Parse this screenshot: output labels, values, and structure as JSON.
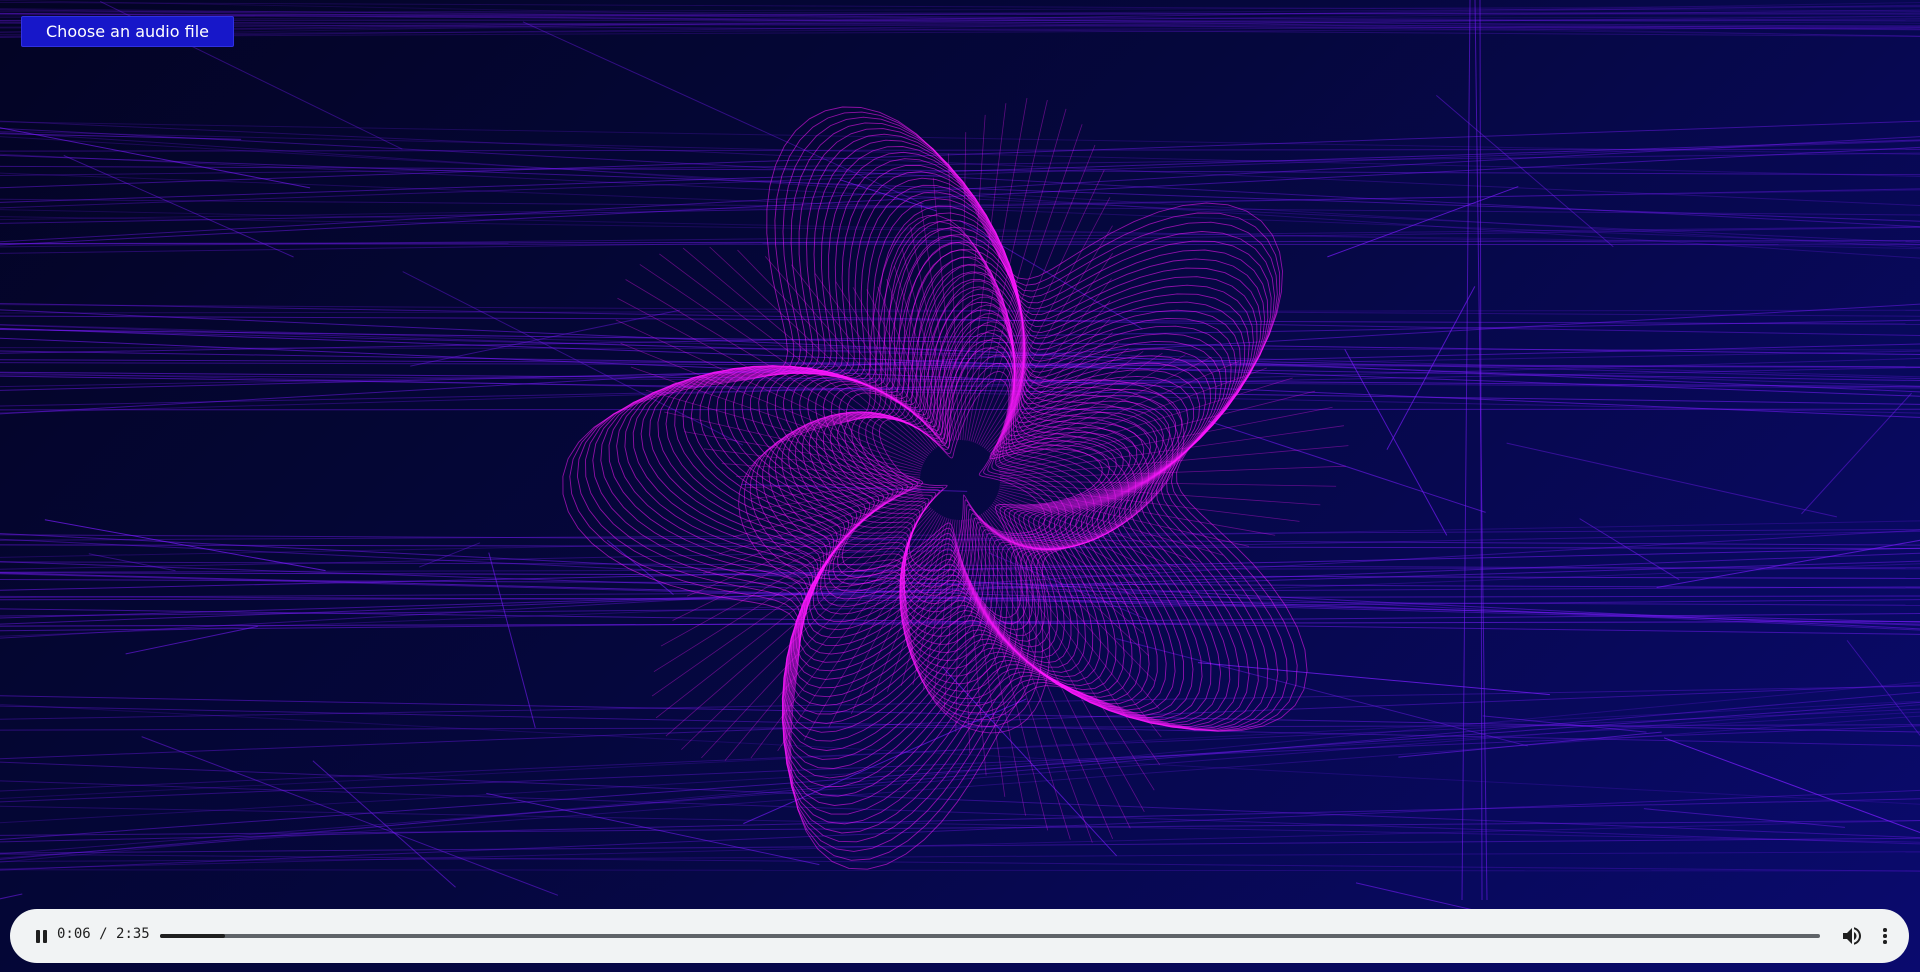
{
  "upload": {
    "label": "Choose an audio file"
  },
  "player": {
    "current_time": "0:06",
    "separator": " / ",
    "duration": "2:35",
    "progress_fraction": 0.039,
    "state": "playing"
  },
  "visual": {
    "background_colors": [
      "#030424",
      "#05073d",
      "#0a0a6e"
    ],
    "grid_color": "#7a1cff",
    "blob_color": "#ff18ff"
  },
  "icons": {
    "play_pause": "pause-icon",
    "volume": "volume-icon",
    "menu": "more-vert-icon"
  }
}
